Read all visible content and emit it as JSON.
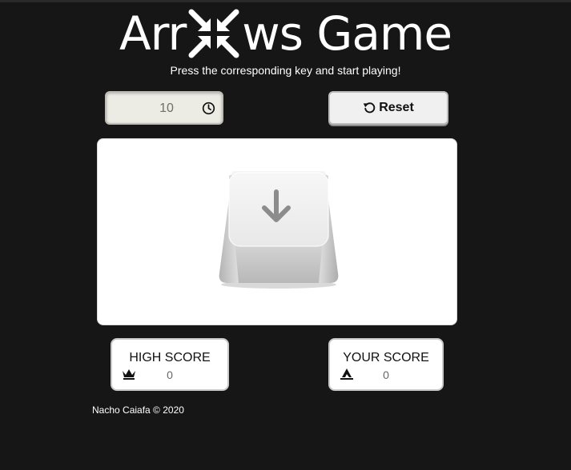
{
  "header": {
    "title_left": "Arr",
    "title_right": "ws Game",
    "subtitle": "Press the corresponding key and start playing!",
    "logo_icon": "compress-arrows-icon"
  },
  "controls": {
    "timer_value": "10",
    "timer_icon": "clock-icon",
    "reset_label": "Reset",
    "reset_icon": "undo-icon"
  },
  "game": {
    "current_key": "down-arrow-key",
    "key_icon": "arrow-down-icon"
  },
  "scores": {
    "high": {
      "label": "HIGH SCORE",
      "value": "0",
      "icon": "crown-icon"
    },
    "yours": {
      "label": "YOUR SCORE",
      "value": "0",
      "icon": "medal-icon"
    }
  },
  "footer": {
    "credit": "Nacho Caiafa © 2020"
  }
}
